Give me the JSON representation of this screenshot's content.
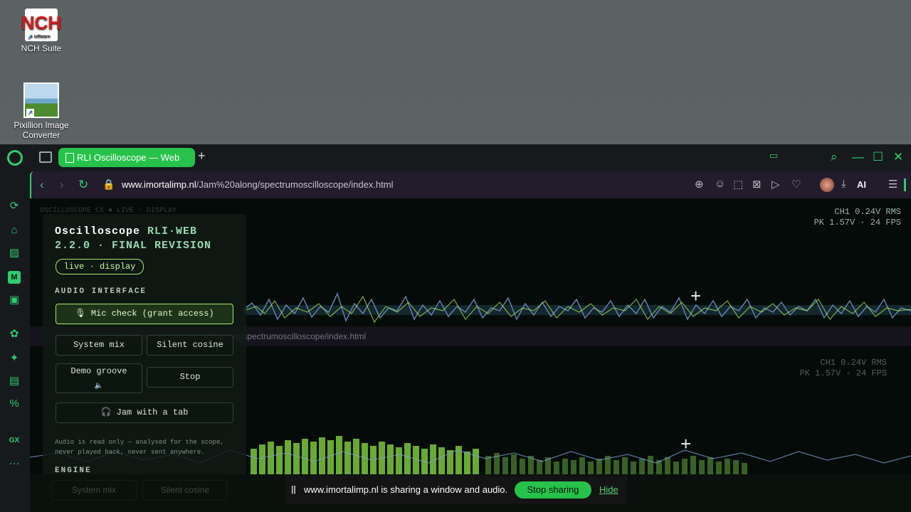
{
  "desktop": {
    "icons": [
      {
        "label": "NCH Suite",
        "art": "NCH",
        "art_sub": "Software"
      },
      {
        "label": "Pixillion Image Converter"
      }
    ]
  },
  "browser": {
    "tab_title": "RLI Oscilloscope — Web",
    "url_domain": "www.imortalimp.nl",
    "url_path": "/Jam%20along/spectrumoscilloscope/index.html",
    "ai_label": "AI"
  },
  "scope": {
    "readout_line1": "CH1 0.24V RMS",
    "readout_line2": "PK 1.57V  ·  24 FPS",
    "ghost_header": "OSCILLOSCOPE CX      ● LIVE · DISPLAY"
  },
  "panel": {
    "title_a": "Oscilloscope",
    "title_b": "RLI·WEB",
    "title_c": "2.2.0 · FINAL REVISION",
    "pill": "live · display",
    "audio_label": "AUDIO INTERFACE",
    "mic_button": "Mic check (grant access)",
    "system_mix": "System mix",
    "silent_cosine": "Silent cosine",
    "demo_groove": "Demo groove",
    "stop": "Stop",
    "jam_tab": "Jam with a tab",
    "note": "Audio is read only — analysed for the scope, never played back, never sent anywhere.",
    "engine_label": "ENGINE"
  },
  "sharebar": {
    "message": "www.imortalimp.nl is sharing a window and audio.",
    "stop_label": "Stop sharing",
    "hide_label": "Hide"
  },
  "colors": {
    "accent": "#27c24c",
    "scope_green": "#9ee35c",
    "scope_blue": "#7f9fd8"
  }
}
